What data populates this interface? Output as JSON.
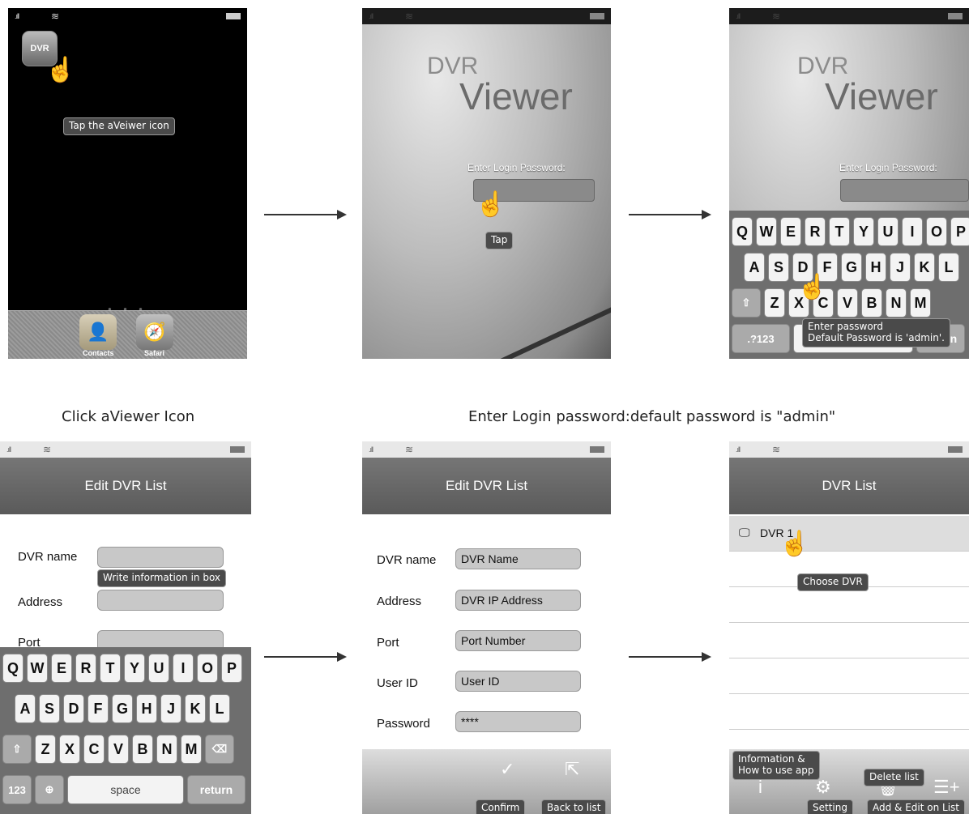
{
  "step1": {
    "app_icon_label": "DVR",
    "tooltip": "Tap the aVeiwer icon",
    "dock": {
      "contacts_label": "Contacts",
      "safari_label": "Safari"
    },
    "caption": "Click aViewer Icon"
  },
  "step2": {
    "logo_small": "DVR",
    "logo_big": "Viewer",
    "prompt": "Enter Login Password:",
    "tooltip": "Tap"
  },
  "step3": {
    "logo_small": "DVR",
    "logo_big": "Viewer",
    "prompt": "Enter Login Password:",
    "tooltip_line1": "Enter password",
    "tooltip_line2": "Default Password is 'admin'.",
    "keys_row1": [
      "Q",
      "W",
      "E",
      "R",
      "T",
      "Y",
      "U",
      "I",
      "O",
      "P"
    ],
    "keys_row2": [
      "A",
      "S",
      "D",
      "F",
      "G",
      "H",
      "J",
      "K",
      "L"
    ],
    "keys_row3": [
      "Z",
      "X",
      "C",
      "V",
      "B",
      "N",
      "M"
    ],
    "mode_key": ".?123",
    "space_key": "space",
    "return_key": "return"
  },
  "login_caption": "Enter Login password:default password is \"admin\"",
  "step4": {
    "title": "Edit DVR List",
    "labels": [
      "DVR name",
      "Address",
      "Port"
    ],
    "tooltip": "Write information in box",
    "keys_row1": [
      "Q",
      "W",
      "E",
      "R",
      "T",
      "Y",
      "U",
      "I",
      "O",
      "P"
    ],
    "keys_row2": [
      "A",
      "S",
      "D",
      "F",
      "G",
      "H",
      "J",
      "K",
      "L"
    ],
    "keys_row3": [
      "Z",
      "X",
      "C",
      "V",
      "B",
      "N",
      "M"
    ],
    "mode_key": "123",
    "space_key": "space",
    "return_key": "return"
  },
  "step5": {
    "title": "Edit DVR List",
    "fields": [
      {
        "label": "DVR name",
        "value": "DVR Name"
      },
      {
        "label": "Address",
        "value": "DVR IP Address"
      },
      {
        "label": "Port",
        "value": "Port Number"
      },
      {
        "label": "User ID",
        "value": "User ID"
      },
      {
        "label": "Password",
        "value": "****"
      }
    ],
    "confirm_label": "Confirm",
    "back_label": "Back to list"
  },
  "step6": {
    "title": "DVR List",
    "item": "DVR 1",
    "tooltip": "Choose DVR",
    "info_tip_line1": "Information &",
    "info_tip_line2": "How to use app",
    "delete_tip": "Delete list",
    "setting_label": "Setting",
    "add_label": "Add & Edit on List"
  }
}
